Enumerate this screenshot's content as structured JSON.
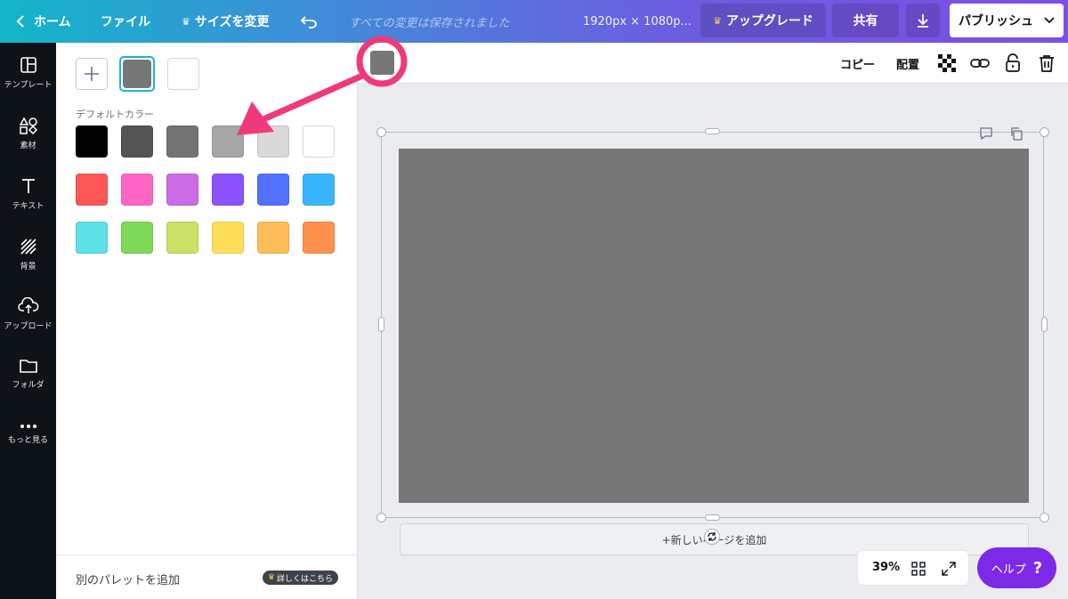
{
  "topbar": {
    "home": "ホーム",
    "file": "ファイル",
    "resize": "サイズを変更",
    "autosave": "すべての変更は保存されました",
    "dimensions": "1920px × 1080p...",
    "upgrade": "アップグレード",
    "share": "共有",
    "publish": "パブリッシュ"
  },
  "rail": [
    {
      "label": "テンプレート",
      "icon": "template-icon"
    },
    {
      "label": "素材",
      "icon": "elements-icon"
    },
    {
      "label": "テキスト",
      "icon": "text-icon"
    },
    {
      "label": "背景",
      "icon": "background-icon"
    },
    {
      "label": "アップロード",
      "icon": "upload-icon"
    },
    {
      "label": "フォルダ",
      "icon": "folder-icon"
    },
    {
      "label": "もっと見る",
      "icon": "more-icon"
    }
  ],
  "panel": {
    "document_colors": [
      "#777777",
      "#ffffff"
    ],
    "default_colors_label": "デフォルトカラー",
    "default_colors": [
      "#000000",
      "#545454",
      "#737373",
      "#a6a6a6",
      "#d9d9d9",
      "#ffffff",
      "#ff5757",
      "#ff66c4",
      "#cb6ce6",
      "#8c52ff",
      "#5271ff",
      "#38b6ff",
      "#5ce1e6",
      "#7ed957",
      "#c9e265",
      "#ffde59",
      "#ffbd59",
      "#ff914d"
    ],
    "footer_label": "別のパレットを追加",
    "footer_badge": "詳しくはこちら"
  },
  "context_toolbar": {
    "selected_color": "#777777",
    "copy": "コピー",
    "arrange": "配置"
  },
  "canvas": {
    "page_color": "#777777",
    "add_page": "+新しいページを追加",
    "zoom": "39%",
    "help": "ヘルプ",
    "help_q": "?"
  },
  "colors": {
    "accent": "#1ab7c6",
    "annotation": "#f0397a",
    "help_button": "#7d2ae8",
    "rail_bg": "#0e1318"
  }
}
